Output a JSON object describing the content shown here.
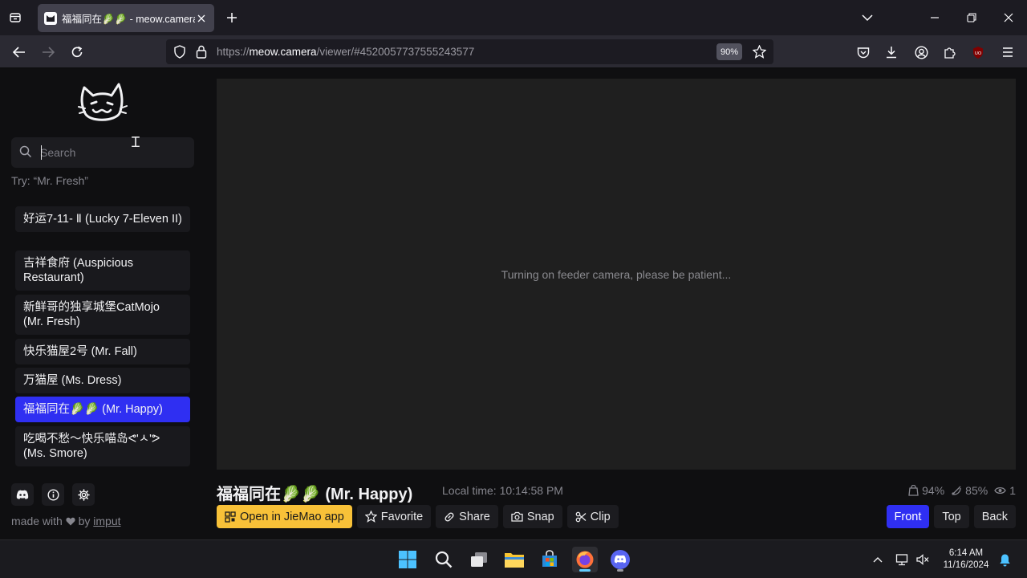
{
  "browser": {
    "tab_title": "福福同在🥬🥬 - meow.camera",
    "url_scheme": "https://",
    "url_host": "meow.camera",
    "url_path": "/viewer/#4520057737555243577",
    "zoom": "90%"
  },
  "sidebar": {
    "search_placeholder": "Search",
    "hint": "Try: “Mr. Fresh”",
    "items": [
      {
        "label": "好运7-11- Ⅱ (Lucky 7-Eleven II)",
        "active": false
      },
      {
        "label": "吉祥食府 (Auspicious Restaurant)",
        "active": false
      },
      {
        "label": "新鲜哥的独享城堡CatMojo (Mr. Fresh)",
        "active": false
      },
      {
        "label": "快乐猫屋2号 (Mr. Fall)",
        "active": false
      },
      {
        "label": "万猫屋 (Ms. Dress)",
        "active": false
      },
      {
        "label": "福福同在🥬🥬 (Mr. Happy)",
        "active": true
      },
      {
        "label": "吃喝不愁～快乐喵岛ᕙ'ㅅ'ᕗ (Ms. Smore)",
        "active": false
      }
    ],
    "made_with_prefix": "made with",
    "made_with_by": "by",
    "author": "imput"
  },
  "viewer": {
    "status": "Turning on feeder camera, please be patient...",
    "title": "福福同在🥬🥬 (Mr. Happy)",
    "local_time": "Local time: 10:14:58 PM",
    "food_level": "94%",
    "signal": "85%",
    "viewers": "1"
  },
  "actions": {
    "open_app": "Open in JieMao app",
    "favorite": "Favorite",
    "share": "Share",
    "snap": "Snap",
    "clip": "Clip"
  },
  "views": {
    "front": "Front",
    "top": "Top",
    "back": "Back",
    "active": "front"
  },
  "taskbar": {
    "time": "6:14 AM",
    "date": "11/16/2024"
  },
  "colors": {
    "accent": "#2f2ff2",
    "primary_button": "#f8c138",
    "video_bg": "#1f1f1f"
  }
}
